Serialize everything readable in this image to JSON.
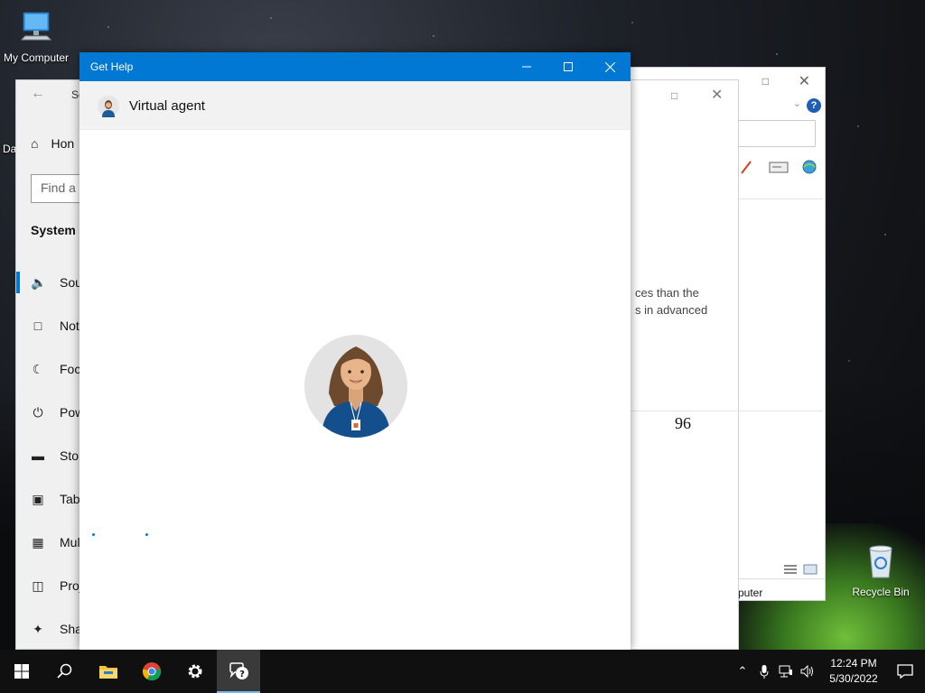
{
  "desktop": {
    "icons": [
      {
        "label": "My Computer"
      },
      {
        "label": "Recycle Bin"
      }
    ],
    "partial_label": "Da"
  },
  "settings_window": {
    "title": "Se",
    "home_label": "Hon",
    "find_placeholder": "Find a s",
    "section": "System",
    "items": [
      {
        "label": "Sou",
        "icon": "speaker-icon"
      },
      {
        "label": "Not",
        "icon": "notification-icon"
      },
      {
        "label": "Focu",
        "icon": "moon-icon"
      },
      {
        "label": "Pow",
        "icon": "power-icon"
      },
      {
        "label": "Stor",
        "icon": "storage-icon"
      },
      {
        "label": "Tabl",
        "icon": "tablet-icon"
      },
      {
        "label": "Mul",
        "icon": "multitask-icon"
      },
      {
        "label": "Proj",
        "icon": "project-icon"
      },
      {
        "label": "Sha",
        "icon": "share-icon"
      }
    ]
  },
  "mid_window": {
    "text_line1": "ces than the",
    "text_line2": "s in advanced",
    "number": "96"
  },
  "explorer_window": {
    "help_label": "?",
    "status": "puter"
  },
  "get_help": {
    "title": "Get Help",
    "agent_name": "Virtual agent"
  },
  "taskbar": {
    "time": "12:24 PM",
    "date": "5/30/2022"
  },
  "colors": {
    "accent": "#0078d4",
    "titlebar": "#0078d4",
    "taskbar": "#101010"
  }
}
